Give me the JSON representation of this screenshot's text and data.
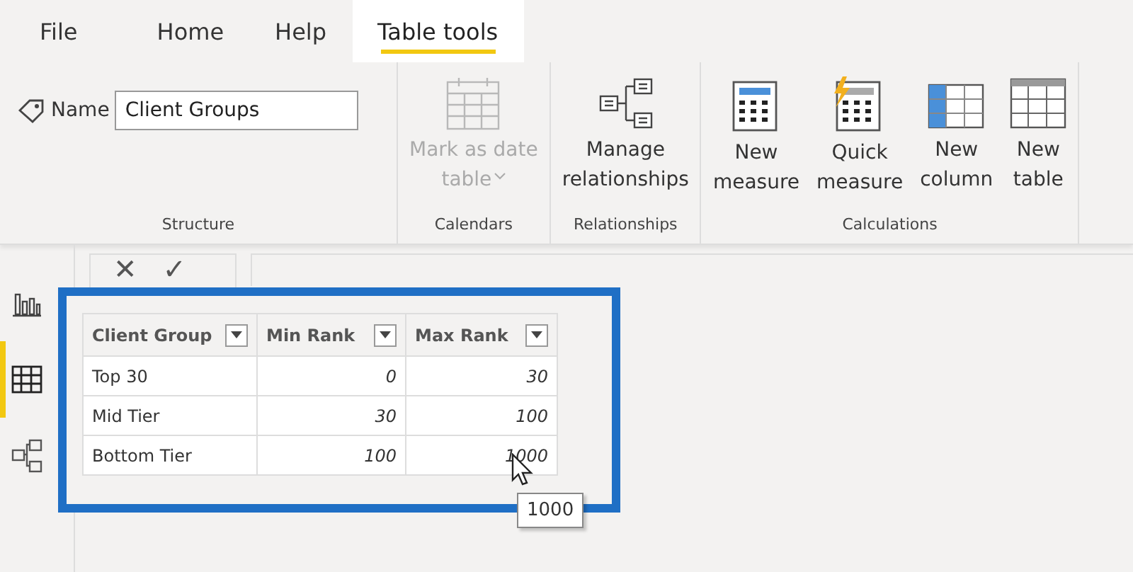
{
  "tabs": [
    {
      "label": "File",
      "selected": false
    },
    {
      "label": "Home",
      "selected": false
    },
    {
      "label": "Help",
      "selected": false
    },
    {
      "label": "Table tools",
      "selected": true
    }
  ],
  "ribbon": {
    "groups": [
      {
        "label": "Structure",
        "kind": "name",
        "name_label": "Name",
        "name_value": "Client Groups"
      },
      {
        "label": "Calendars",
        "kind": "buttons",
        "buttons": [
          {
            "kind": "calendar",
            "lines": [
              "Mark as date",
              "table"
            ],
            "dropdown": true,
            "disabled": true
          }
        ]
      },
      {
        "label": "Relationships",
        "kind": "buttons",
        "buttons": [
          {
            "kind": "relationships",
            "lines": [
              "Manage",
              "relationships"
            ],
            "dropdown": false,
            "disabled": false
          }
        ]
      },
      {
        "label": "Calculations",
        "kind": "buttons",
        "buttons": [
          {
            "kind": "measure",
            "lines": [
              "New",
              "measure"
            ],
            "dropdown": false,
            "disabled": false
          },
          {
            "kind": "quick-measure",
            "lines": [
              "Quick",
              "measure"
            ],
            "dropdown": false,
            "disabled": false
          },
          {
            "kind": "column",
            "lines": [
              "New",
              "column"
            ],
            "dropdown": false,
            "disabled": false
          },
          {
            "kind": "table",
            "lines": [
              "New",
              "table"
            ],
            "dropdown": false,
            "disabled": false
          }
        ]
      }
    ]
  },
  "views": [
    {
      "kind": "report",
      "selected": false
    },
    {
      "kind": "data",
      "selected": true
    },
    {
      "kind": "model",
      "selected": false
    }
  ],
  "formula_bar": {
    "cancel": "✕",
    "commit": "✓"
  },
  "table": {
    "columns": [
      "Client Group",
      "Min Rank",
      "Max Rank"
    ],
    "rows": [
      [
        "Top 30",
        "0",
        "30"
      ],
      [
        "Mid Tier",
        "30",
        "100"
      ],
      [
        "Bottom Tier",
        "100",
        "1000"
      ]
    ]
  },
  "tooltip": "1000"
}
